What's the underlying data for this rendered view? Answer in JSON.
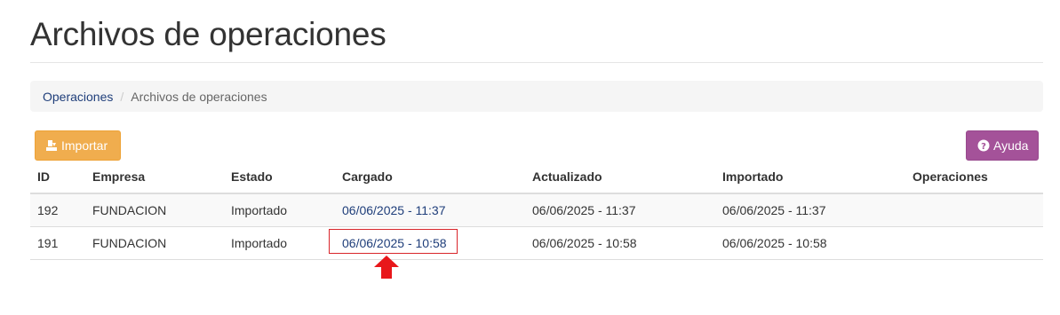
{
  "header": {
    "title": "Archivos de operaciones"
  },
  "breadcrumb": {
    "items": [
      {
        "label": "Operaciones"
      },
      {
        "label": "Archivos de operaciones"
      }
    ],
    "separator": "/"
  },
  "toolbar": {
    "import_label": "Importar",
    "import_icon": "import-icon",
    "help_label": "Ayuda",
    "help_icon": "question-circle-icon"
  },
  "table": {
    "columns": [
      "ID",
      "Empresa",
      "Estado",
      "Cargado",
      "Actualizado",
      "Importado",
      "Operaciones"
    ],
    "rows": [
      {
        "id": "192",
        "empresa": "FUNDACION",
        "estado": "Importado",
        "cargado": "06/06/2025 - 11:37",
        "actualizado": "06/06/2025 - 11:37",
        "importado": "06/06/2025 - 11:37",
        "operaciones": ""
      },
      {
        "id": "191",
        "empresa": "FUNDACION",
        "estado": "Importado",
        "cargado": "06/06/2025 - 10:58",
        "actualizado": "06/06/2025 - 10:58",
        "importado": "06/06/2025 - 10:58",
        "operaciones": ""
      }
    ]
  },
  "colors": {
    "link": "#1f3e7a",
    "import_button": "#f0ad4e",
    "help_button": "#a45299",
    "annotation": "#d9252a"
  }
}
